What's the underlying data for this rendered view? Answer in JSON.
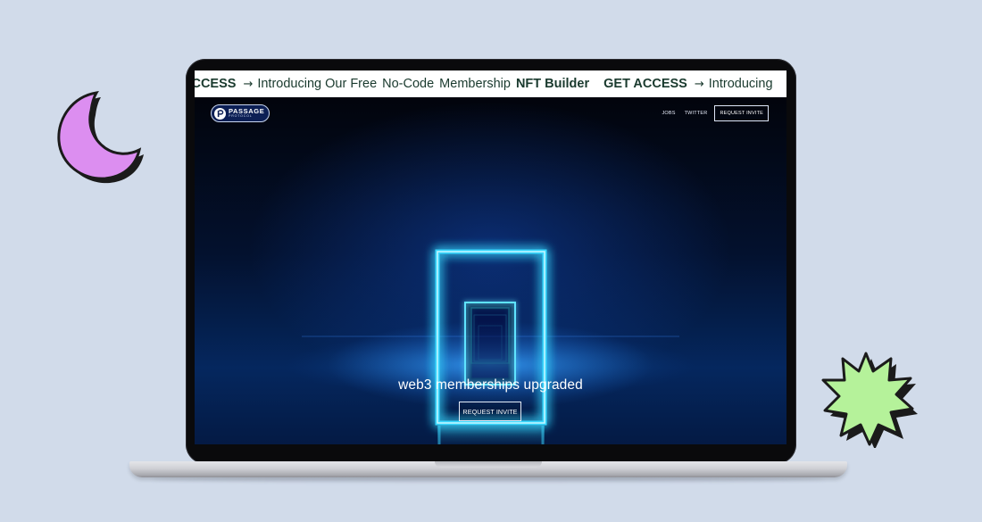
{
  "marquee": {
    "items": [
      {
        "text": "ACCESS",
        "bold": true
      },
      {
        "text": "→",
        "arrow": true
      },
      {
        "text": "Introducing Our Free",
        "bold": false
      },
      {
        "text": "No-Code",
        "bold": false
      },
      {
        "text": "Membership",
        "bold": false
      },
      {
        "text": "NFT Builder",
        "bold": true
      },
      {
        "text": "GET ACCESS",
        "bold": true
      },
      {
        "text": "→",
        "arrow": true
      },
      {
        "text": "Introducing",
        "bold": false
      }
    ]
  },
  "logo": {
    "name": "PASSAGE",
    "sub": "PROTOCOL",
    "icon": "passage-p-icon"
  },
  "nav": {
    "jobs": "JOBS",
    "twitter": "TWITTER",
    "request_invite": "REQUEST INVITE"
  },
  "hero": {
    "headline": "web3 memberships upgraded",
    "cta": "REQUEST INVITE"
  },
  "colors": {
    "background": "#d1dbea",
    "moon": "#dc8ef0",
    "star": "#b5f29a",
    "glow": "#39d8ff",
    "marquee_text": "#1a3a2e"
  },
  "decor": {
    "left_shape": "crescent-moon-icon",
    "right_shape": "starburst-icon"
  }
}
